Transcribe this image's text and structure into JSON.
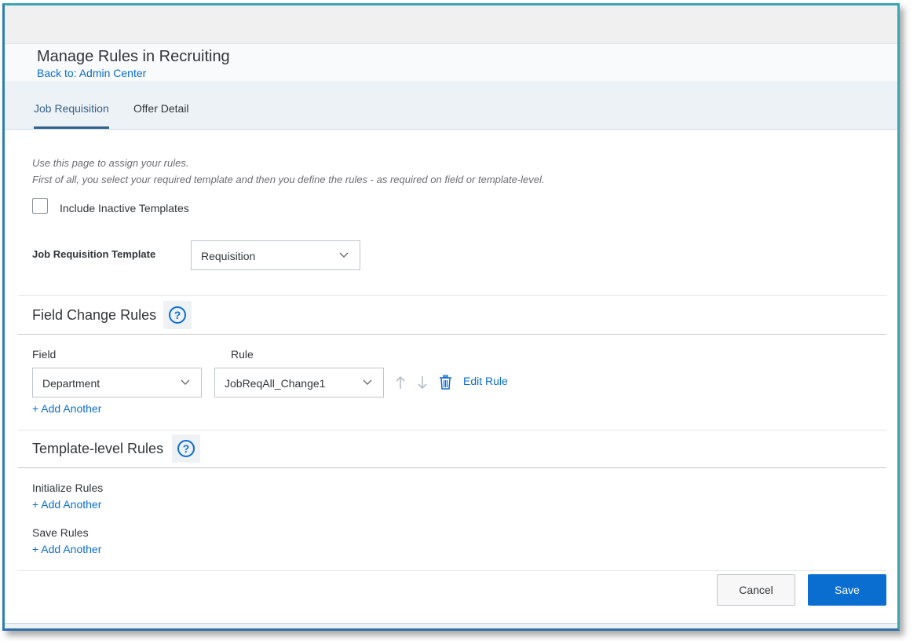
{
  "header": {
    "title": "Manage Rules in Recruiting",
    "back_link": "Back to: Admin Center"
  },
  "tabs": [
    {
      "label": "Job Requisition",
      "active": true
    },
    {
      "label": "Offer Detail",
      "active": false
    }
  ],
  "intro": {
    "line1": "Use this page to assign your rules.",
    "line2": "First of all, you select your required template and then you define the rules - as required on field or template-level."
  },
  "include_inactive": {
    "label": "Include Inactive Templates",
    "checked": false
  },
  "template_select": {
    "label": "Job Requisition Template",
    "value": "Requisition"
  },
  "field_change": {
    "title": "Field Change Rules",
    "field_header": "Field",
    "rule_header": "Rule",
    "rows": [
      {
        "field": "Department",
        "rule": "JobReqAll_Change1",
        "edit_label": "Edit Rule"
      }
    ],
    "add_label": "+ Add Another"
  },
  "template_level": {
    "title": "Template-level Rules",
    "initialize_label": "Initialize Rules",
    "initialize_add": "+ Add Another",
    "save_label": "Save Rules",
    "save_add": "+ Add Another"
  },
  "footer": {
    "cancel_label": "Cancel",
    "save_label": "Save"
  },
  "colors": {
    "accent": "#0a6ed1",
    "tab_active": "#346187",
    "frame_border": "#3aa6b4"
  },
  "icons": [
    "help-icon",
    "chevron-down-icon",
    "arrow-up-icon",
    "arrow-down-icon",
    "trash-icon"
  ]
}
